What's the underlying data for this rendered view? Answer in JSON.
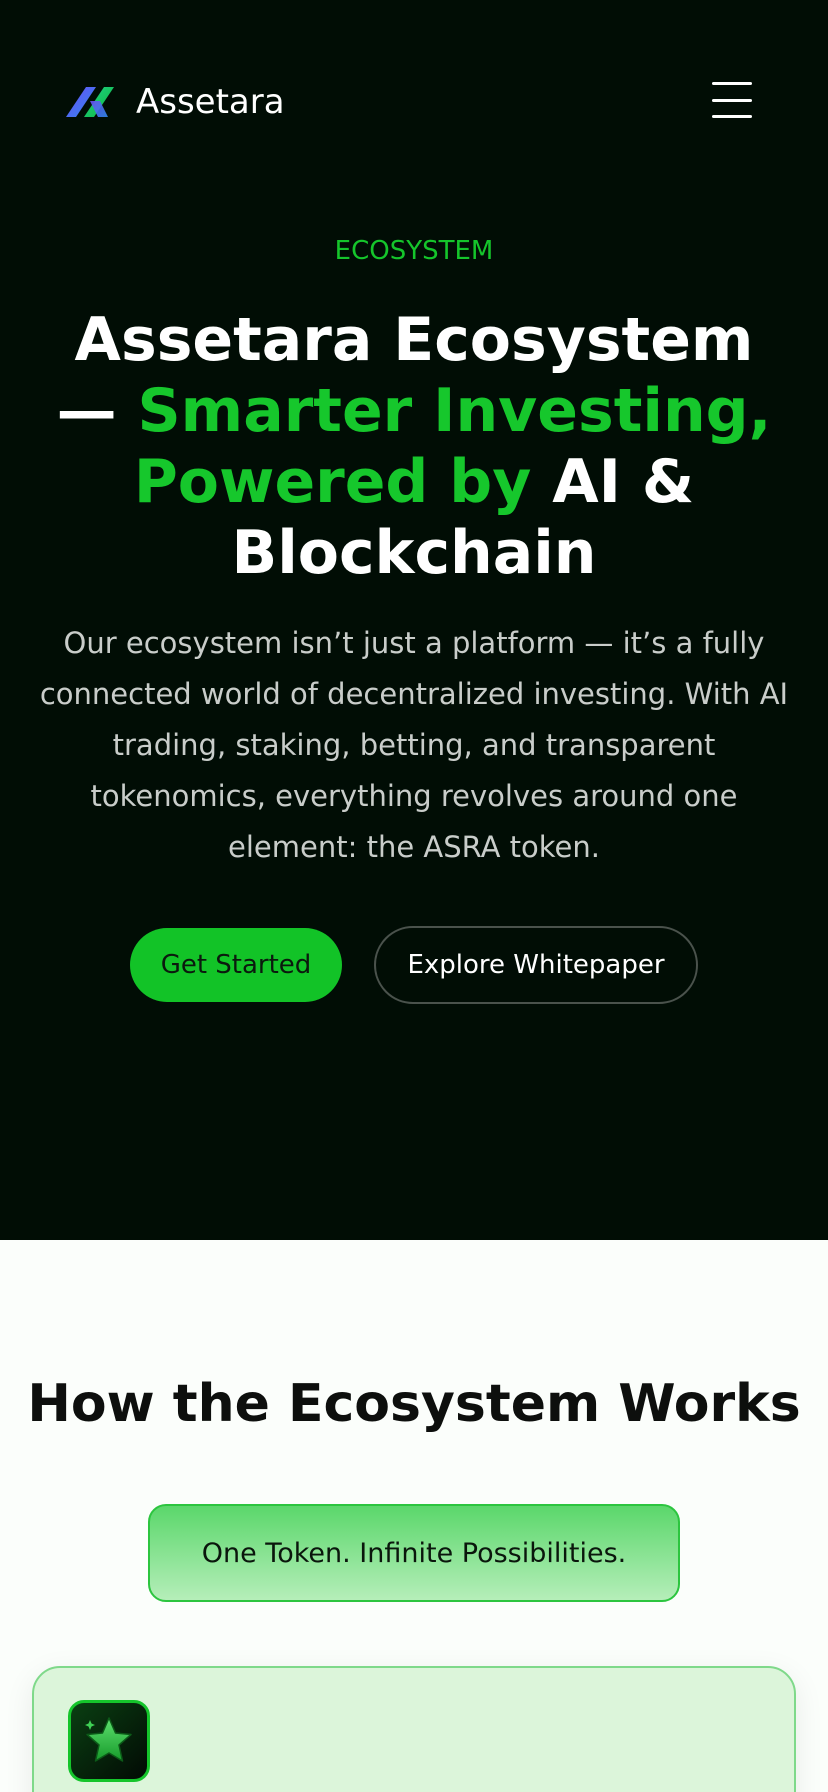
{
  "header": {
    "brand_name": "Assetara",
    "logo_icon": "assetara-logo-icon",
    "menu_icon": "hamburger-menu-icon"
  },
  "hero": {
    "eyebrow": "ECOSYSTEM",
    "title_part1": "Assetara Ecosystem — ",
    "title_highlight": "Smarter Investing, Powered by",
    "title_part2": " AI & Blockchain",
    "description": "Our ecosystem isn’t just a platform — it’s a fully connected world of decentralized investing. With AI trading, staking, betting, and transparent tokenomics, everything revolves around one element: the ASRA token.",
    "primary_button": "Get Started",
    "secondary_button": "Explore Whitepaper"
  },
  "ecosystem": {
    "title": "How the Ecosystem Works",
    "tagline": "One Token. Infinite Possibilities.",
    "card_icon": "star-icon"
  },
  "colors": {
    "hero_background": "#010d05",
    "accent_green": "#16c72c",
    "page_background": "#fbfefb"
  }
}
